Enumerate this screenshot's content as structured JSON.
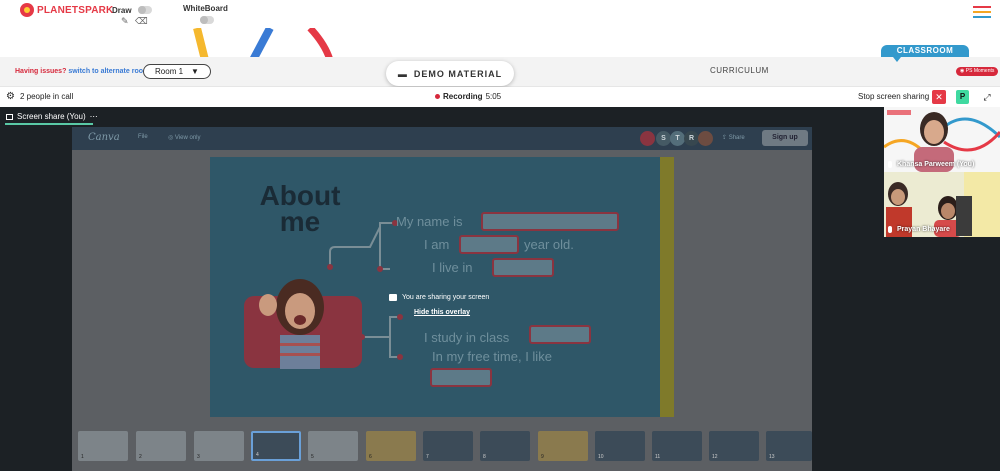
{
  "brand": {
    "name": "PLANETSPARK"
  },
  "toolbar": {
    "draw_label": "Draw",
    "whiteboard_label": "WhiteBoard"
  },
  "nav": {
    "issue_text": "Having issues?",
    "alt_room_link": "switch to alternate room",
    "room_value": "Room 1",
    "demo_material": "DEMO MATERIAL",
    "curriculum": "CURRICULUM",
    "classroom": "CLASSROOM",
    "ps_moments": "PS Moments"
  },
  "call": {
    "people": "2 people in call",
    "recording_label": "Recording",
    "recording_time": "5:05",
    "stop_share": "Stop screen sharing",
    "avatar_initial": "P"
  },
  "share_tab": {
    "label": "Screen share (You)",
    "more": "⋯"
  },
  "canva": {
    "logo": "Canva",
    "menu_file": "File",
    "menu_view": "View only",
    "share": "Share",
    "signup": "Sign up",
    "avatars": [
      "S",
      "T",
      "R"
    ]
  },
  "slide": {
    "title": "About me",
    "lines": [
      "My name is",
      "I am",
      "year old.",
      "I live in",
      "I study in class",
      "In my free time, I like"
    ]
  },
  "overlay": {
    "message": "You are sharing your screen",
    "hide_link": "Hide this overlay"
  },
  "thumbnails": [
    "1",
    "2",
    "3",
    "4",
    "5",
    "6",
    "7",
    "8",
    "9",
    "10",
    "11",
    "12",
    "13"
  ],
  "participants": [
    {
      "name": "Khansa Parweem (You)"
    },
    {
      "name": "Prayan Bhayare"
    }
  ],
  "colors": {
    "brand_red": "#e53946",
    "accent_blue": "#3399cc",
    "accent_green": "#3fd9a0",
    "stage_dark": "#1c2125"
  }
}
